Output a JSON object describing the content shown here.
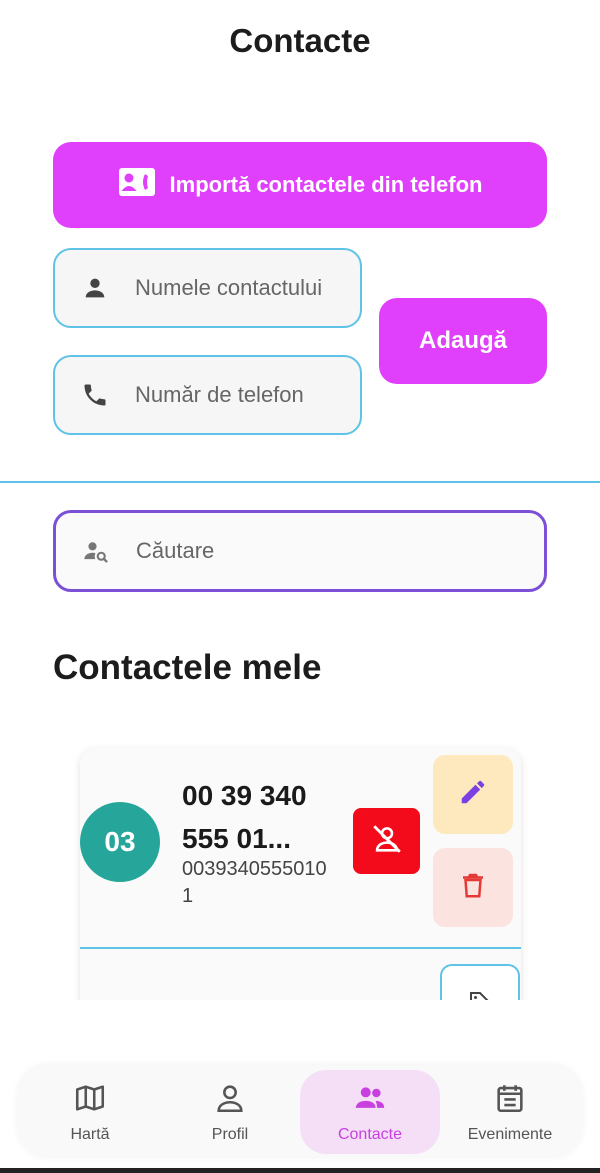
{
  "header": {
    "title": "Contacte"
  },
  "import_button": {
    "label": "Importă contactele din telefon",
    "icon": "contact-phone-icon"
  },
  "form": {
    "name_placeholder": "Numele contactului",
    "phone_placeholder": "Număr de telefon",
    "add_label": "Adaugă"
  },
  "search": {
    "placeholder": "Căutare",
    "icon": "person-search-icon"
  },
  "section": {
    "title": "Contactele mele"
  },
  "contacts": [
    {
      "initials": "03",
      "name": "00 39 340 555 01...",
      "phone": "00393405550101",
      "avatar_color": "#26a69a"
    }
  ],
  "nav": {
    "items": [
      {
        "label": "Hartă",
        "icon": "map-icon",
        "active": false
      },
      {
        "label": "Profil",
        "icon": "person-icon",
        "active": false
      },
      {
        "label": "Contacte",
        "icon": "people-icon",
        "active": true
      },
      {
        "label": "Evenimente",
        "icon": "calendar-icon",
        "active": false
      }
    ]
  },
  "colors": {
    "accent": "#e040fb",
    "field_border": "#5ec3e6",
    "search_border": "#7b4fd6",
    "block": "#f30b1c",
    "edit_bg": "#fde9bd",
    "delete_bg": "#fbe3e0"
  }
}
